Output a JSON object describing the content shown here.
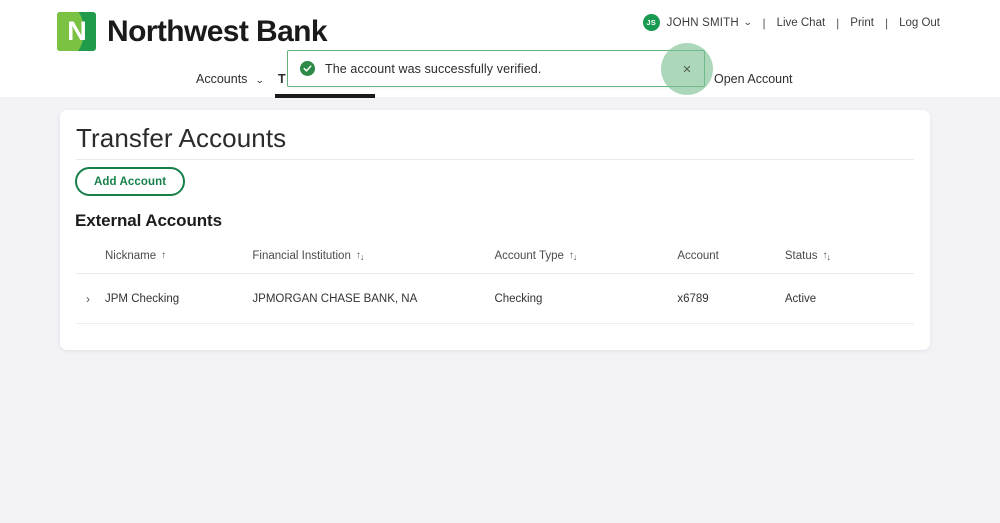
{
  "header": {
    "brand": {
      "mark_letter": "N",
      "name": "Northwest Bank"
    },
    "util_nav": {
      "avatar_initials": "JS",
      "user_name": "JOHN SMITH",
      "caret": "⌄",
      "separator": "|",
      "links": [
        {
          "label": "Live Chat"
        },
        {
          "label": "Print"
        },
        {
          "label": "Log Out"
        }
      ]
    },
    "main_nav": [
      {
        "label": "Accounts",
        "has_caret": true,
        "active": false
      },
      {
        "label": "T",
        "has_caret": false,
        "active": true
      },
      {
        "label": "Open Account",
        "has_caret": false,
        "active": false
      }
    ],
    "nav_caret": "⌄"
  },
  "toast": {
    "message": "The account was successfully verified.",
    "icon": "check-circle-icon",
    "close_label": "×",
    "border_color": "#63b37e",
    "icon_color": "#2d8a46",
    "highlight_color": "#7abf91"
  },
  "card": {
    "page_title": "Transfer Accounts",
    "add_account_label": "Add Account",
    "section_title": "External Accounts",
    "accent_color": "#17804a"
  },
  "table": {
    "columns": [
      {
        "label": "Nickname",
        "sort": "asc"
      },
      {
        "label": "Financial Institution",
        "sort": "both"
      },
      {
        "label": "Account Type",
        "sort": "both"
      },
      {
        "label": "Account",
        "sort": "none"
      },
      {
        "label": "Status",
        "sort": "both"
      }
    ],
    "sort_glyphs": {
      "asc": "↑",
      "up": "↑",
      "down": "↓"
    },
    "expander_glyph": "›",
    "rows": [
      {
        "nickname": "JPM Checking",
        "financial_institution": "JPMORGAN CHASE BANK, NA",
        "account_type": "Checking",
        "account": "x6789",
        "status": "Active"
      }
    ]
  }
}
